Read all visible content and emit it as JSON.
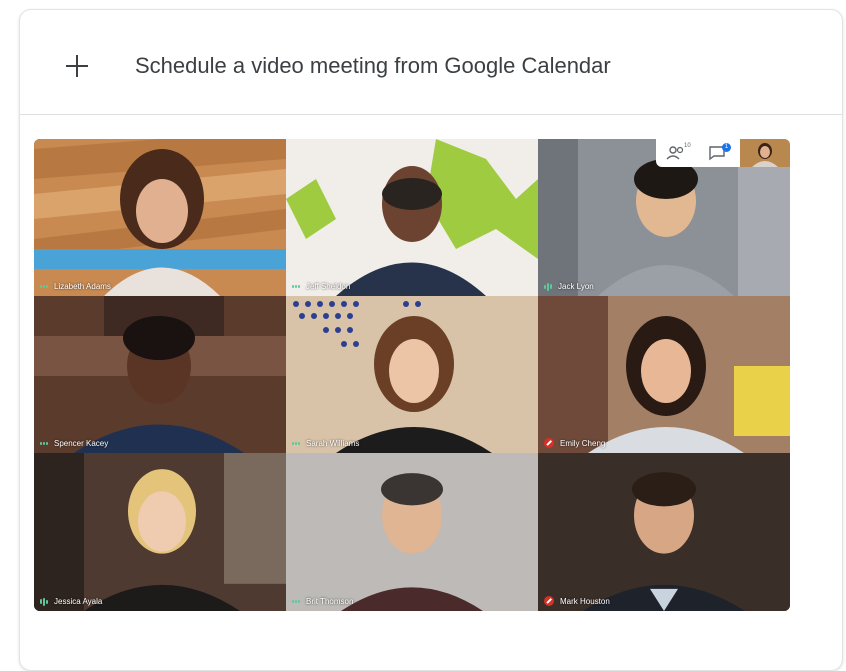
{
  "schedule": {
    "label": "Schedule a video meeting from Google Calendar",
    "icon": "plus-icon"
  },
  "meeting": {
    "controls": {
      "people_count": "10",
      "chat_badge": "1"
    },
    "participants": [
      {
        "name": "Lizabeth Adams",
        "audio": "speaking"
      },
      {
        "name": "Jeff Sheldon",
        "audio": "speaking"
      },
      {
        "name": "Jack Lyon",
        "audio": "speaking"
      },
      {
        "name": "Spencer Kacey",
        "audio": "speaking"
      },
      {
        "name": "Sarah Williams",
        "audio": "speaking"
      },
      {
        "name": "Emily Cheng",
        "audio": "muted"
      },
      {
        "name": "Jessica Ayala",
        "audio": "speaking"
      },
      {
        "name": "Brit Thomson",
        "audio": "speaking"
      },
      {
        "name": "Mark Houston",
        "audio": "muted"
      }
    ]
  },
  "colors": {
    "accent_blue": "#1a73e8",
    "speaking_green": "#5ec79b",
    "muted_red": "#d93025",
    "text": "#3c4043"
  }
}
